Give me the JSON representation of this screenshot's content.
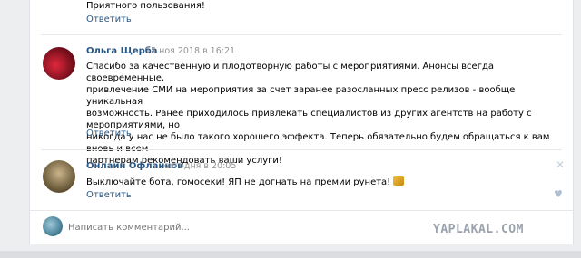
{
  "top_comment": {
    "text": "Приятного пользования!",
    "reply": "Ответить"
  },
  "comments": [
    {
      "author": "Ольга Щерба",
      "date": "15 ноя 2018 в 16:21",
      "lines": [
        "Спасибо за качественную и плодотворную работы с мероприятиями. Анонсы всегда своевременные,",
        "привлечение СМИ на мероприятия за счет заранее разосланных пресс релизов - вообще уникальная",
        "возможность. Ранее приходилось привлекать специалистов из других агентств на работу с мероприятиями, но",
        "никогда у нас не было такого хорошего эффекта. Теперь обязательно будем обращаться к вам вновь и всем",
        "партнерам рекомендовать ваши услуги!"
      ],
      "reply": "Ответить",
      "avatar_color": "#a01a2a"
    },
    {
      "author": "Онлайн Офлайнов",
      "date": "сегодня в 20:05",
      "text": "Выключайте бота, гомосеки! ЯП не догнать на премии рунета!",
      "reply": "Ответить",
      "close_icon": "close-icon",
      "like_icon": "heart-icon",
      "avatar_color": "#6b5a3a"
    }
  ],
  "composer": {
    "placeholder": "Написать комментарий..."
  },
  "watermark": "YAPLAKAL.COM",
  "colors": {
    "link": "#2a5885",
    "muted": "#939393",
    "background": "#edeef0"
  }
}
